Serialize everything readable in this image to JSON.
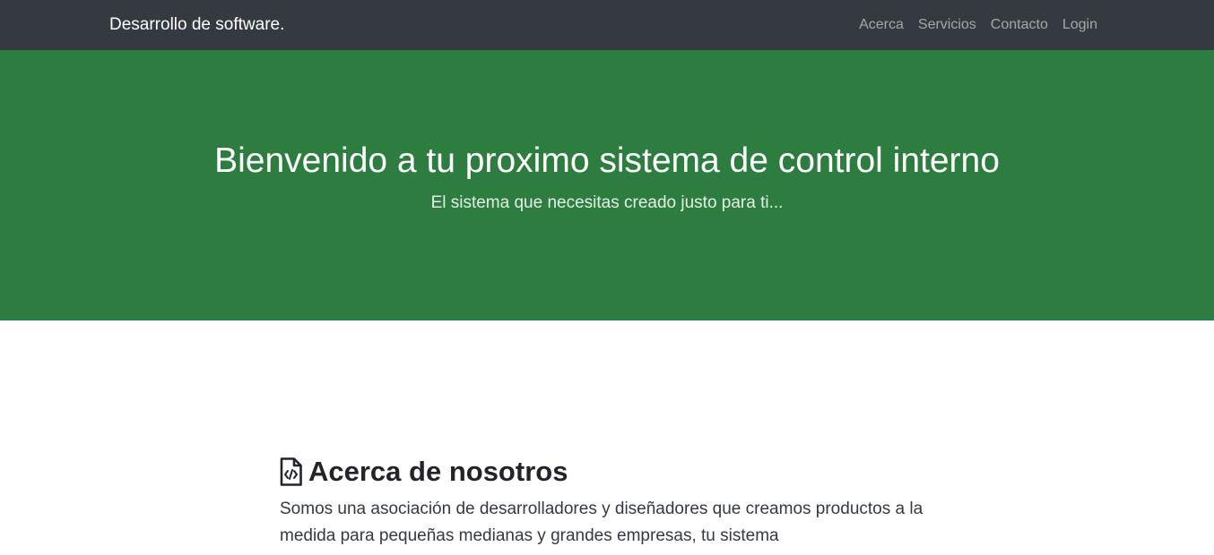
{
  "navbar": {
    "brand": "Desarrollo de software.",
    "links": [
      {
        "label": "Acerca"
      },
      {
        "label": "Servicios"
      },
      {
        "label": "Contacto"
      },
      {
        "label": "Login"
      }
    ]
  },
  "hero": {
    "title": "Bienvenido a tu proximo sistema de control interno",
    "subtitle": "El sistema que necesitas creado justo para ti..."
  },
  "about": {
    "icon": "file-code-icon",
    "title": "Acerca de nosotros",
    "text": "Somos una asociación de desarrolladores y diseñadores que creamos productos a la medida para pequeñas medianas y grandes empresas, tu sistema"
  },
  "colors": {
    "navbar_bg": "#343a40",
    "hero_bg": "#2e7d40",
    "text_dark": "#212529"
  }
}
